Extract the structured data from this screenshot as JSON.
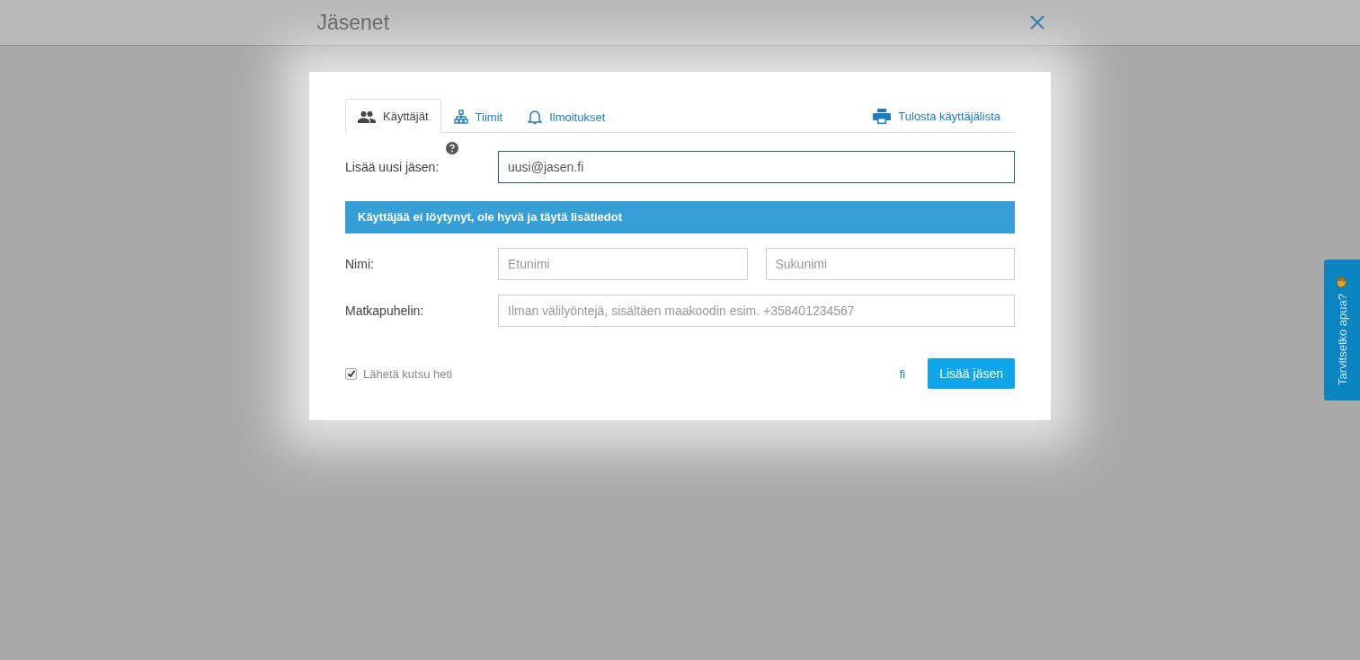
{
  "header": {
    "title": "Jäsenet"
  },
  "tabs": [
    {
      "label": "Käyttäjät",
      "kind": "users",
      "selected": true
    },
    {
      "label": "Tiimit",
      "kind": "teams",
      "selected": false
    },
    {
      "label": "Ilmoitukset",
      "kind": "notifications",
      "selected": false
    }
  ],
  "print_link": {
    "label": "Tulosta käyttäjälista"
  },
  "add_member": {
    "label": "Lisää uusi jäsen:",
    "value": "uusi@jasen.fi"
  },
  "alert": {
    "text": "Käyttäjää ei löytynyt, ole hyvä ja täytä lisätiedot"
  },
  "name_row": {
    "label": "Nimi:",
    "first_placeholder": "Etunimi",
    "last_placeholder": "Sukunimi"
  },
  "phone_row": {
    "label": "Matkapuhelin:",
    "placeholder": "Ilman välilyöntejä, sisältäen maakoodin esim. +358401234567"
  },
  "send_invite": {
    "label": "Lähetä kutsu heti",
    "checked": true
  },
  "language": "fi",
  "submit": "Lisää jäsen",
  "help_tab": {
    "label": "Tarvitsetko apua?"
  }
}
